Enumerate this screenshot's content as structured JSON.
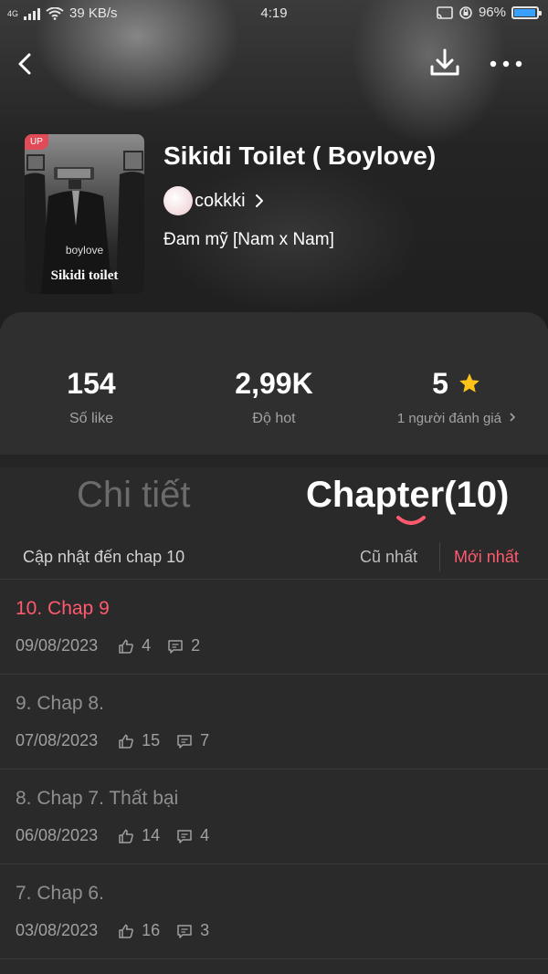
{
  "status": {
    "network": "4G",
    "speed": "39 KB/s",
    "time": "4:19",
    "battery": "96%",
    "battery_level": 0.96
  },
  "book": {
    "title": "Sikidi Toilet ( Boylove)",
    "author": "cokkki",
    "genre": "Đam mỹ [Nam x Nam]",
    "cover": {
      "badge": "UP",
      "subtitle": "boylove",
      "title": "Sikidi toilet"
    }
  },
  "stats": {
    "likes": {
      "value": "154",
      "label": "Số like"
    },
    "hot": {
      "value": "2,99K",
      "label": "Độ hot"
    },
    "rating": {
      "value": "5",
      "label": "1 người đánh giá"
    }
  },
  "tabs": {
    "details": "Chi tiết",
    "chapters": "Chapter(10)"
  },
  "sortbar": {
    "updated": "Cập nhật đến chap 10",
    "oldest": "Cũ nhất",
    "newest": "Mới nhất"
  },
  "chapters": [
    {
      "name": "10. Chap 9",
      "date": "09/08/2023",
      "likes": "4",
      "comments": "2"
    },
    {
      "name": "9. Chap 8.",
      "date": "07/08/2023",
      "likes": "15",
      "comments": "7"
    },
    {
      "name": "8. Chap 7. Thất bại",
      "date": "06/08/2023",
      "likes": "14",
      "comments": "4"
    },
    {
      "name": "7. Chap 6.",
      "date": "03/08/2023",
      "likes": "16",
      "comments": "3"
    }
  ],
  "colors": {
    "accent": "#ff5a6e",
    "star": "#ffc21a",
    "background": "#2a2a2a"
  }
}
